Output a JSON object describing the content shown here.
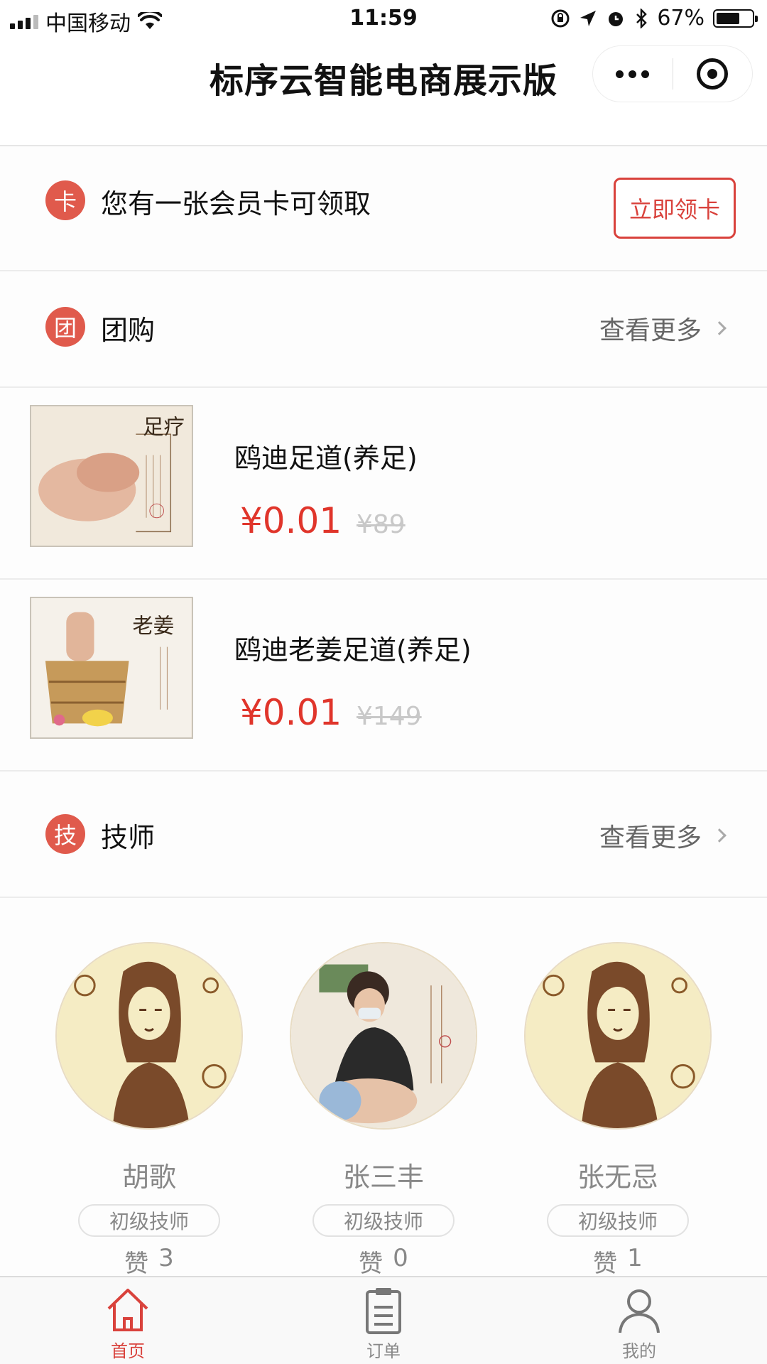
{
  "status_bar": {
    "carrier": "中国移动",
    "time": "11:59",
    "battery": "67%",
    "battery_level": 0.67
  },
  "nav": {
    "title": "标序云智能电商展示版"
  },
  "member_card": {
    "badge": "卡",
    "text": "您有一张会员卡可领取",
    "button": "立即领卡"
  },
  "group_buy": {
    "badge": "团",
    "title": "团购",
    "more": "查看更多",
    "products": [
      {
        "name": "鸥迪足道(养足)",
        "price": "¥0.01",
        "old_price": "¥89",
        "image_text": "足疗"
      },
      {
        "name": "鸥迪老姜足道(养足)",
        "price": "¥0.01",
        "old_price": "¥149",
        "image_text": "老姜"
      }
    ]
  },
  "technicians": {
    "badge": "技",
    "title": "技师",
    "more": "查看更多",
    "items": [
      {
        "name": "胡歌",
        "level": "初级技师",
        "likes_label": "赞",
        "likes": "3"
      },
      {
        "name": "张三丰",
        "level": "初级技师",
        "likes_label": "赞",
        "likes": "0"
      },
      {
        "name": "张无忌",
        "level": "初级技师",
        "likes_label": "赞",
        "likes": "1"
      }
    ]
  },
  "tabbar": {
    "items": [
      {
        "label": "首页",
        "icon": "home-icon",
        "active": true
      },
      {
        "label": "订单",
        "icon": "clipboard-icon",
        "active": false
      },
      {
        "label": "我的",
        "icon": "user-icon",
        "active": false
      }
    ]
  },
  "colors": {
    "accent": "#d9423c",
    "badge": "#e05a4c",
    "price": "#e0352b"
  }
}
